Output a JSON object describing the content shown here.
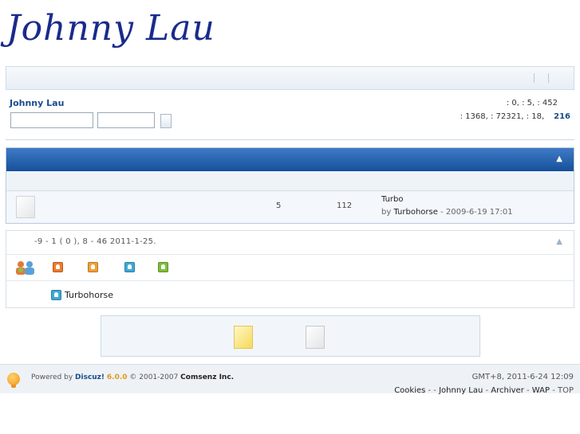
{
  "header": {
    "logo_text": "Johnny Lau"
  },
  "user": {
    "name": "Johnny Lau"
  },
  "stats": {
    "line1": ": 0,   : 5,   : 452",
    "line2": ": 1368,   : 72321,   : 18,",
    "online_count": "216"
  },
  "forum": {
    "topics": "5",
    "posts": "112",
    "last_post_title": "Turbo",
    "last_post_by_prefix": "by ",
    "last_post_author": "Turbohorse",
    "last_post_time": " - 2009-6-19 17:01"
  },
  "online": {
    "summary": "-9   - 1  ( 0  ), 8    -     46   2011-1-25.",
    "members": [
      {
        "name": "Turbohorse"
      }
    ]
  },
  "footer": {
    "powered_prefix": "Powered by ",
    "discuz": "Discuz!",
    "version": "6.0.0",
    "copyright": " © 2001-2007 ",
    "company": "Comsenz Inc.",
    "time": "GMT+8,       2011-6-24 12:09",
    "link_cookies": "Cookies",
    "sep1": " -      - ",
    "link_site": "Johnny Lau",
    "sep2": " - ",
    "link_archiver": "Archiver",
    "sep3": " - ",
    "link_wap": "WAP",
    "sep4": " - ",
    "link_top": "TOP"
  },
  "colors": {
    "logo": "#1a2a8c",
    "header_bar": "#16509a",
    "link": "#1a4c8a"
  },
  "icons": [
    "user-group-icon",
    "moderator-icon",
    "member-icon",
    "member-icon",
    "member-icon",
    "new-posts-icon",
    "no-new-posts-icon",
    "forum-icon",
    "bulb-icon"
  ]
}
